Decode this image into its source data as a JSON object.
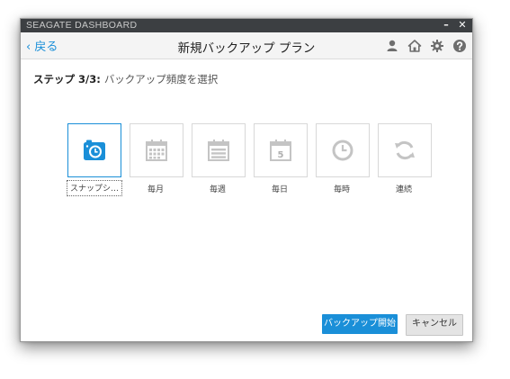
{
  "window": {
    "title": "SEAGATE DASHBOARD",
    "minimize": "–",
    "close": "✕"
  },
  "header": {
    "back_label": "‹ 戻る",
    "title": "新規バックアップ プラン",
    "icons": [
      "user-icon",
      "home-icon",
      "gear-icon",
      "help-icon"
    ]
  },
  "step": {
    "label": "ステップ 3/3:",
    "description": "バックアップ頻度を選択"
  },
  "options": [
    {
      "label": "スナップシ…",
      "icon": "snapshot-camera-icon",
      "selected": true
    },
    {
      "label": "毎月",
      "icon": "calendar-month-icon",
      "selected": false
    },
    {
      "label": "毎週",
      "icon": "calendar-week-icon",
      "selected": false
    },
    {
      "label": "毎日",
      "icon": "calendar-day-icon",
      "day_number": "5",
      "selected": false
    },
    {
      "label": "毎時",
      "icon": "clock-icon",
      "selected": false
    },
    {
      "label": "連続",
      "icon": "sync-icon",
      "selected": false
    }
  ],
  "buttons": {
    "start": "バックアップ開始",
    "cancel": "キャンセル"
  },
  "colors": {
    "accent": "#1a8fd8",
    "titlebar": "#3c3f42",
    "icon_gray": "#c4c4c4"
  }
}
